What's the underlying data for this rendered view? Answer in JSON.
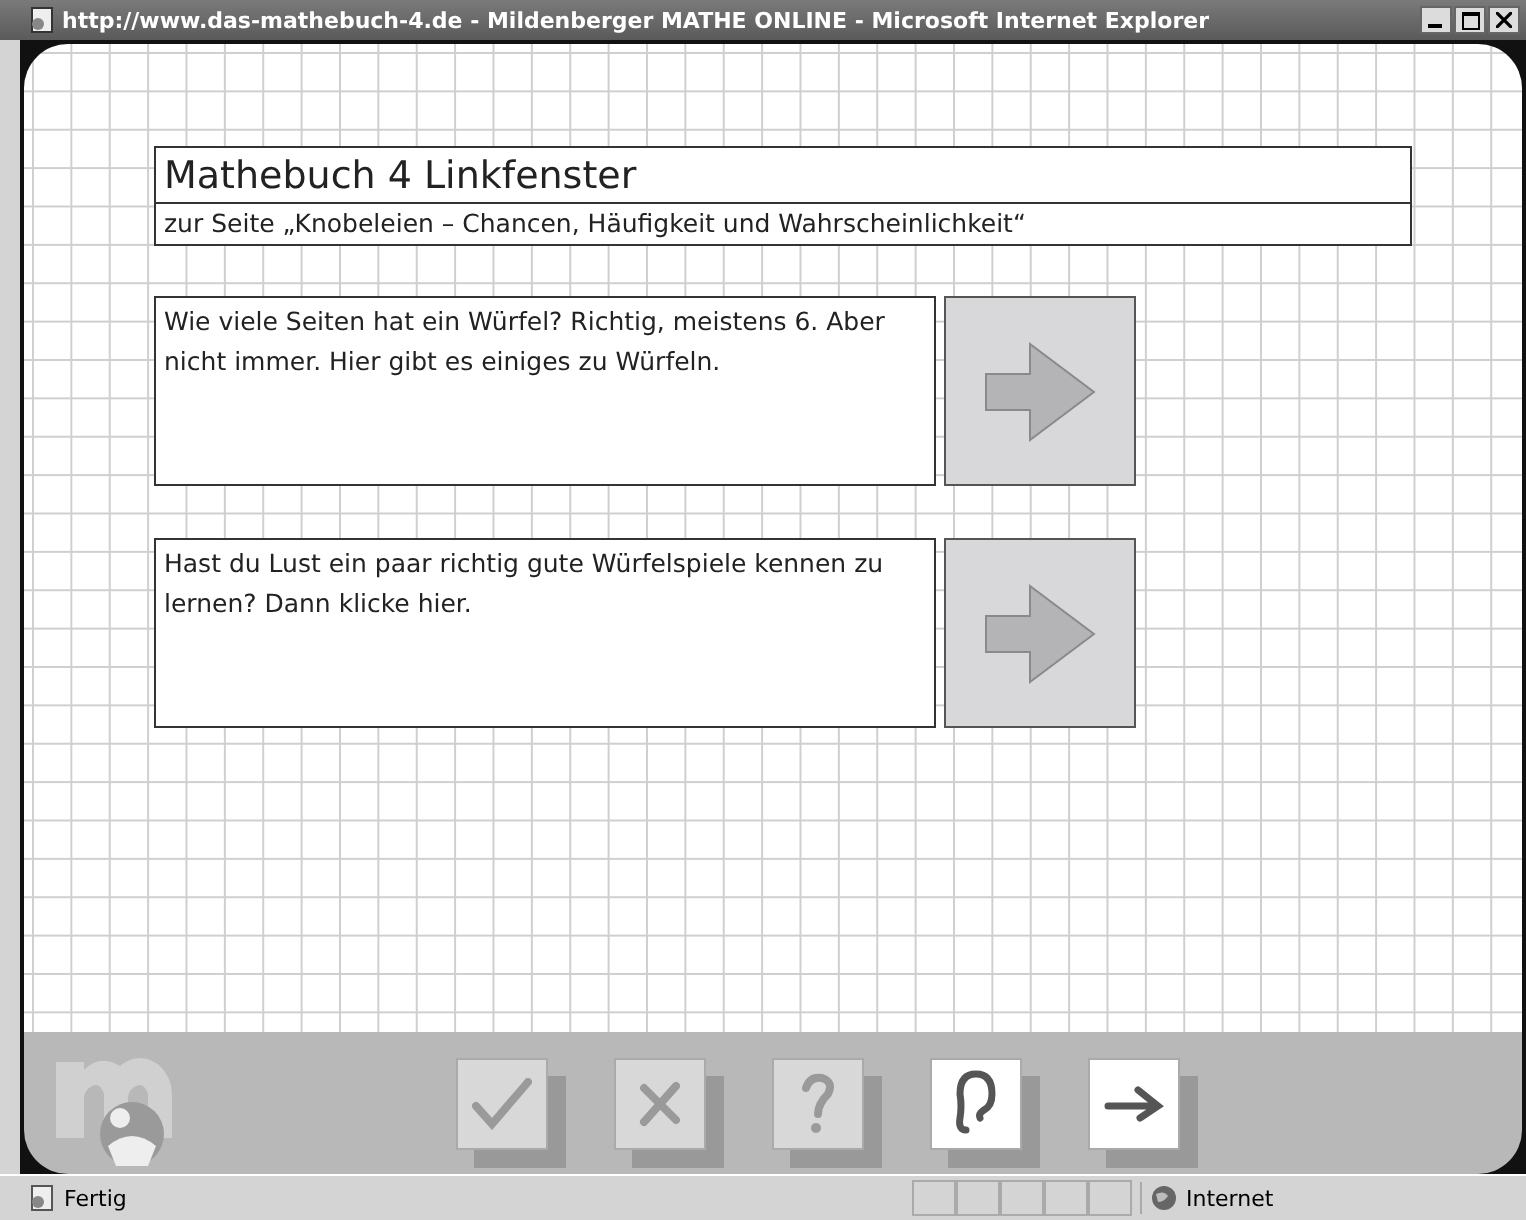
{
  "window": {
    "title": "http://www.das-mathebuch-4.de - Mildenberger MATHE ONLINE - Microsoft Internet Explorer"
  },
  "header": {
    "title": "Mathebuch 4 Linkfenster",
    "subtitle": "zur Seite „Knobeleien – Chancen, Häufigkeit und Wahrscheinlichkeit“"
  },
  "links": [
    {
      "text": "Wie viele Seiten hat ein Würfel? Richtig, meistens 6. Aber nicht immer. Hier gibt es einiges zu Würfeln."
    },
    {
      "text": "Hast du Lust ein paar richtig gute Würfelspiele kennen zu lernen? Dann klicke hier."
    }
  ],
  "toolbar": [
    {
      "kind": "check",
      "disabled": true
    },
    {
      "kind": "cross",
      "disabled": true
    },
    {
      "kind": "question",
      "disabled": true
    },
    {
      "kind": "ear",
      "disabled": false
    },
    {
      "kind": "arrow",
      "disabled": false
    }
  ],
  "status_bar": {
    "text": "Fertig",
    "zone": "Internet"
  }
}
